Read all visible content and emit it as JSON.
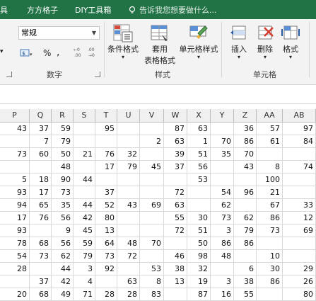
{
  "tabs": {
    "partial_left": "具",
    "fangfang": "方方格子",
    "diy": "DIY工具箱",
    "tell_me": "告诉我您想要做什么..."
  },
  "ribbon": {
    "number_format_value": "常规",
    "number_group_label": "数字",
    "percent_symbol": "%",
    "comma_symbol": ",",
    "styles_group_label": "样式",
    "cells_group_label": "单元格",
    "conditional_format_label": "条件格式",
    "table_format_label_1": "套用",
    "table_format_label_2": "表格格式",
    "cell_style_label": "单元格样式",
    "insert_label": "插入",
    "delete_label": "删除",
    "format_label": "格式"
  },
  "columns": [
    "P",
    "Q",
    "R",
    "S",
    "T",
    "U",
    "V",
    "W",
    "X",
    "Y",
    "Z",
    "AA",
    "AB"
  ],
  "rows": [
    [
      "43",
      "37",
      "59",
      "",
      "95",
      "",
      "",
      "87",
      "63",
      "",
      "36",
      "57",
      "97"
    ],
    [
      "",
      "7",
      "79",
      "",
      "",
      "",
      "2",
      "63",
      "1",
      "70",
      "86",
      "61",
      "84"
    ],
    [
      "73",
      "60",
      "50",
      "21",
      "76",
      "32",
      "",
      "39",
      "51",
      "35",
      "70",
      "",
      ""
    ],
    [
      "",
      "",
      "48",
      "",
      "17",
      "79",
      "45",
      "37",
      "56",
      "",
      "43",
      "8",
      "74"
    ],
    [
      "5",
      "18",
      "90",
      "44",
      "",
      "",
      "",
      "",
      "53",
      "",
      "",
      "100",
      ""
    ],
    [
      "93",
      "17",
      "73",
      "",
      "37",
      "",
      "",
      "72",
      "",
      "54",
      "96",
      "21",
      ""
    ],
    [
      "94",
      "65",
      "35",
      "44",
      "52",
      "43",
      "69",
      "63",
      "",
      "62",
      "",
      "67",
      "33"
    ],
    [
      "17",
      "76",
      "56",
      "42",
      "80",
      "",
      "",
      "55",
      "30",
      "73",
      "62",
      "86",
      "12"
    ],
    [
      "93",
      "",
      "9",
      "45",
      "13",
      "",
      "",
      "72",
      "51",
      "3",
      "79",
      "73",
      "69"
    ],
    [
      "78",
      "68",
      "56",
      "59",
      "64",
      "48",
      "70",
      "",
      "50",
      "86",
      "86",
      "",
      ""
    ],
    [
      "54",
      "73",
      "62",
      "79",
      "73",
      "72",
      "",
      "46",
      "98",
      "48",
      "",
      "10",
      ""
    ],
    [
      "28",
      "",
      "44",
      "3",
      "92",
      "",
      "53",
      "38",
      "32",
      "",
      "6",
      "30",
      "29"
    ],
    [
      "",
      "37",
      "42",
      "4",
      "",
      "63",
      "8",
      "13",
      "19",
      "3",
      "38",
      "86",
      "26"
    ],
    [
      "20",
      "68",
      "49",
      "71",
      "28",
      "28",
      "83",
      "",
      "87",
      "16",
      "55",
      "",
      "80"
    ]
  ]
}
